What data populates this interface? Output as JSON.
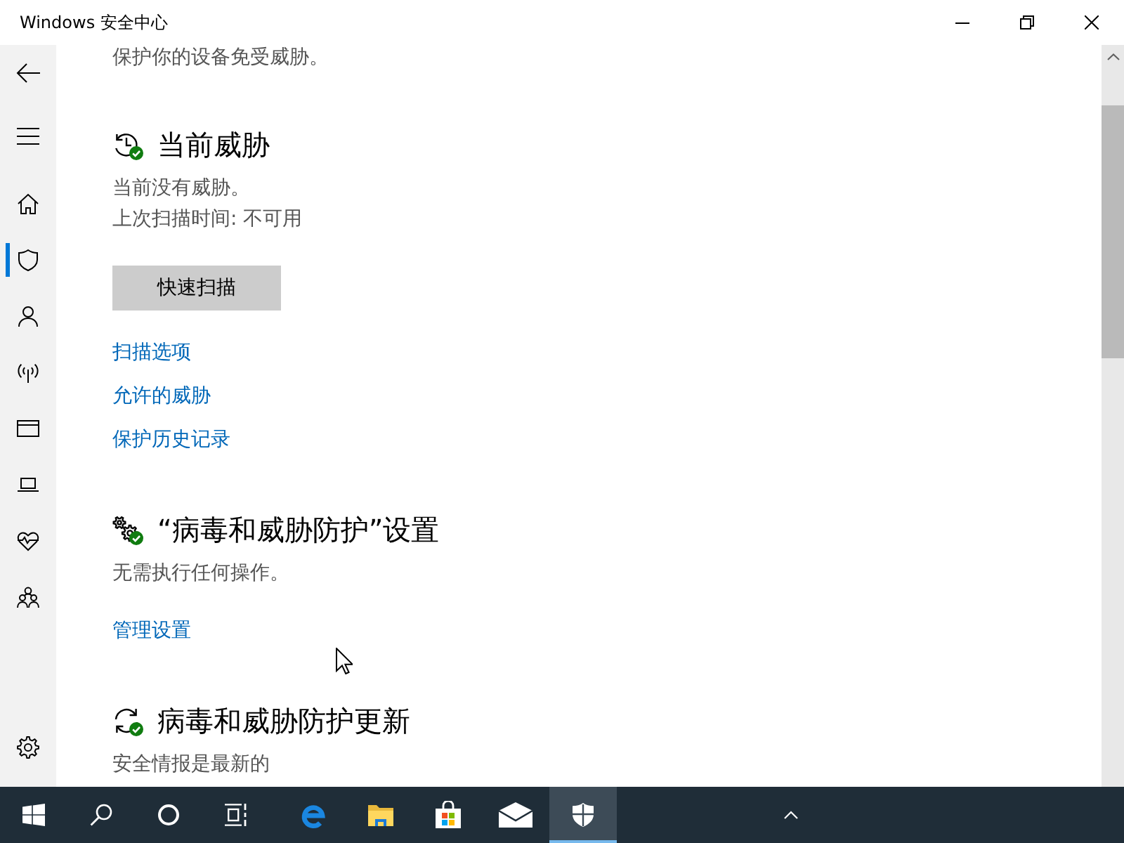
{
  "window": {
    "title": "Windows 安全中心"
  },
  "sidebar": {
    "items": [
      {
        "selected": false
      },
      {
        "selected": true
      },
      {
        "selected": false
      },
      {
        "selected": false
      },
      {
        "selected": false
      },
      {
        "selected": false
      },
      {
        "selected": false
      },
      {
        "selected": false
      }
    ],
    "footer_items": [
      {
        "selected": false
      }
    ]
  },
  "content": {
    "intro": "保护你的设备免受威胁。",
    "sections": [
      {
        "title": "当前威胁",
        "ok": true,
        "lines": [
          "当前没有威胁。",
          "上次扫描时间: 不可用"
        ],
        "button": "快速扫描",
        "links": [
          "扫描选项",
          "允许的威胁",
          "保护历史记录"
        ]
      },
      {
        "title": "“病毒和威胁防护”设置",
        "ok": true,
        "lines": [
          "无需执行任何操作。"
        ],
        "links": [
          "管理设置"
        ]
      },
      {
        "title": "病毒和威胁防护更新",
        "ok": true,
        "lines": [
          "安全情报是最新的"
        ]
      }
    ]
  },
  "taskbar": {
    "apps": [
      {
        "selected": false
      },
      {
        "selected": false
      },
      {
        "selected": false
      },
      {
        "selected": false
      },
      {
        "selected": true
      }
    ]
  }
}
